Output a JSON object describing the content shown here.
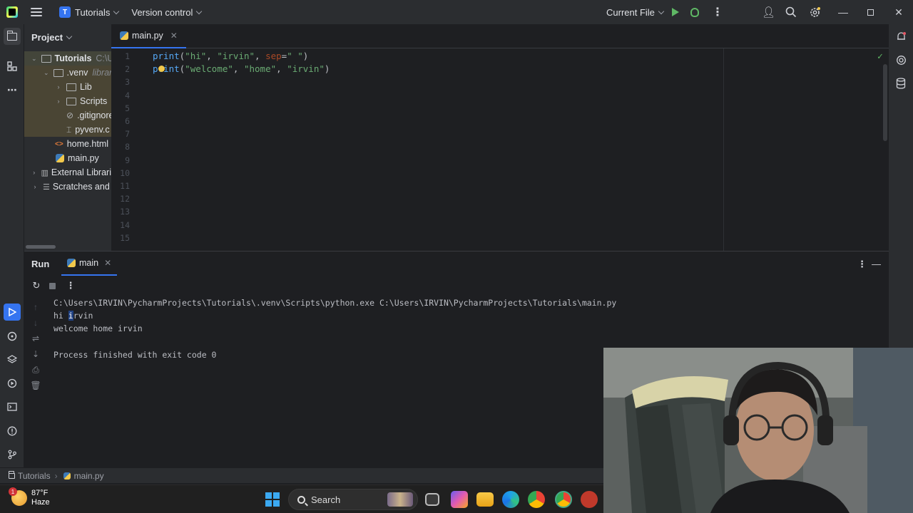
{
  "titlebar": {
    "project_badge": "T",
    "project_name": "Tutorials",
    "version_control": "Version control",
    "run_config": "Current File"
  },
  "project_panel": {
    "title": "Project",
    "tree": [
      {
        "label": "Tutorials",
        "hint": "C:\\U",
        "level": 0,
        "type": "folder",
        "expanded": true
      },
      {
        "label": ".venv",
        "hint": "library",
        "level": 1,
        "type": "folder",
        "expanded": true
      },
      {
        "label": "Lib",
        "level": 2,
        "type": "folder",
        "expanded": false
      },
      {
        "label": "Scripts",
        "level": 2,
        "type": "folder",
        "expanded": false
      },
      {
        "label": ".gitignore",
        "level": 2,
        "type": "ignore-file"
      },
      {
        "label": "pyvenv.c",
        "level": 2,
        "type": "config-file"
      },
      {
        "label": "home.html",
        "level": 1,
        "type": "html-file"
      },
      {
        "label": "main.py",
        "level": 1,
        "type": "python-file"
      },
      {
        "label": "External Librari",
        "level": 0,
        "type": "library"
      },
      {
        "label": "Scratches and ",
        "level": 0,
        "type": "scratches"
      }
    ]
  },
  "editor": {
    "tab_label": "main.py",
    "line_numbers": [
      "1",
      "2",
      "3",
      "4",
      "5",
      "6",
      "7",
      "8",
      "9",
      "10",
      "11",
      "12",
      "13",
      "14",
      "15"
    ],
    "line1": {
      "fn": "print",
      "open": "(",
      "a1": "\"hi\"",
      "c1": ", ",
      "a2": "\"irvin\"",
      "c2": ", ",
      "kw": "sep",
      "eq": "=",
      "a3": "\" \"",
      "close": ")"
    },
    "line2": {
      "fn": "print",
      "open": "(",
      "a1": "\"welcome\"",
      "c1": ", ",
      "a2": "\"home\"",
      "c2": ", ",
      "a3": "\"irvin\"",
      "close": ")"
    }
  },
  "run_panel": {
    "title": "Run",
    "tab_label": "main",
    "console_lines": [
      "C:\\Users\\IRVIN\\PycharmProjects\\Tutorials\\.venv\\Scripts\\python.exe C:\\Users\\IRVIN\\PycharmProjects\\Tutorials\\main.py",
      "hi irvin",
      "welcome home irvin",
      "",
      "Process finished with exit code 0"
    ]
  },
  "statusbar": {
    "crumb_project": "Tutorials",
    "crumb_file": "main.py"
  },
  "taskbar": {
    "weather_temp": "87°F",
    "weather_desc": "Haze",
    "weather_badge": "1",
    "search_label": "Search"
  },
  "colors": {
    "accent": "#3574f0",
    "run_green": "#5fb865",
    "string_green": "#6aab73",
    "function_blue": "#56a8f5",
    "keyword_orange": "#aa4926"
  }
}
